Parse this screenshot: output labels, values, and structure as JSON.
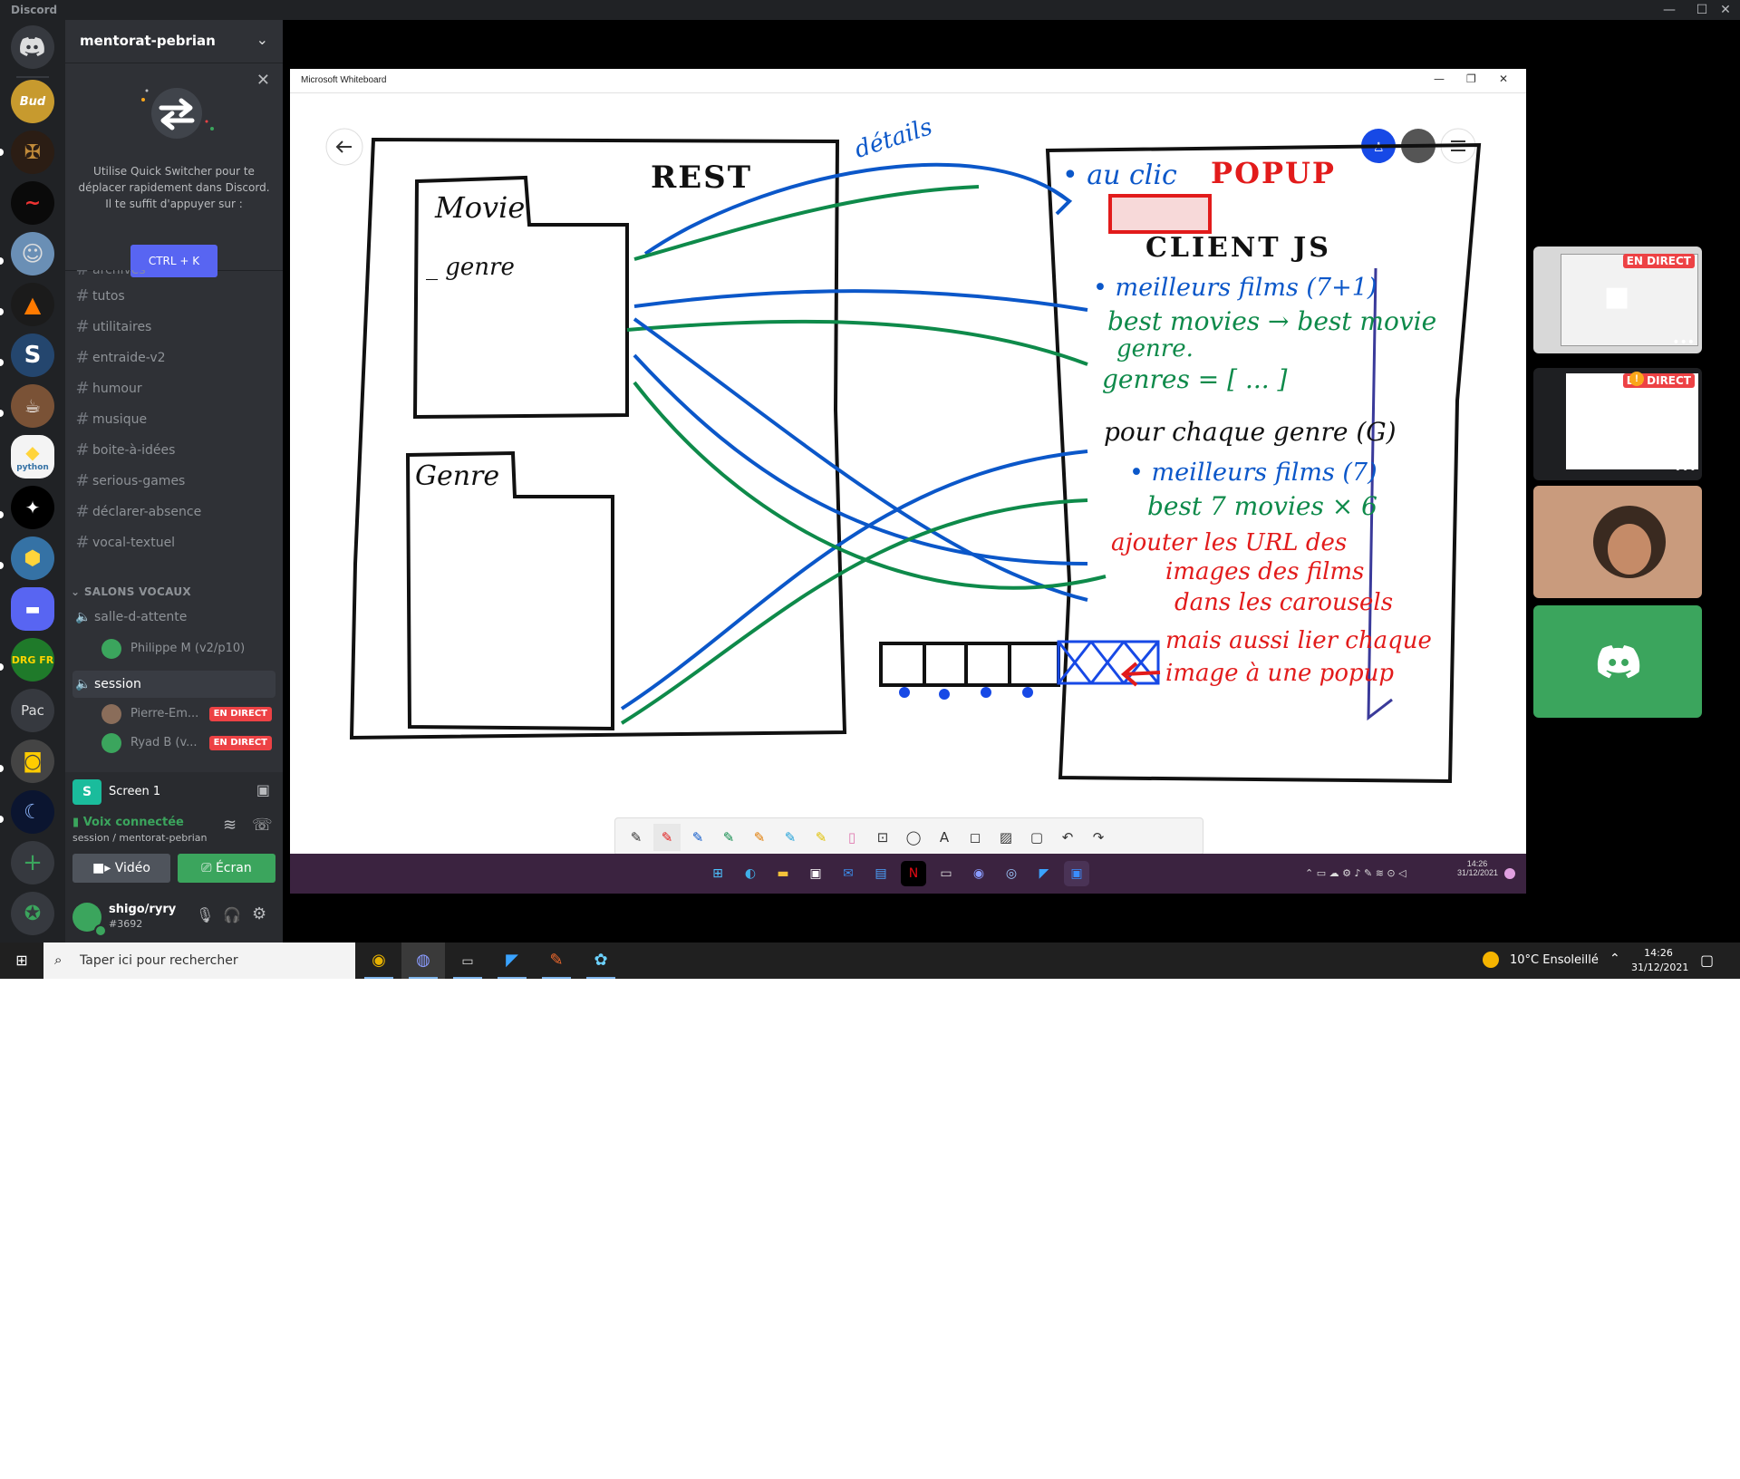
{
  "window": {
    "title": "Discord",
    "minimize": "—",
    "maximize": "☐",
    "close": "✕"
  },
  "guilds": {
    "bud_label": "Bud",
    "pac_label": "Pac",
    "python_label": "python",
    "drg_label": "DRG FR",
    "add_icon": "plus-icon",
    "explore_icon": "compass-icon"
  },
  "server": {
    "name": "mentorat-pebrian"
  },
  "quick_switcher": {
    "text_line1": "Utilise Quick Switcher pour te",
    "text_line2": "déplacer rapidement dans Discord.",
    "text_line3": "Il te suffit d'appuyer sur :",
    "shortcut": "CTRL + K"
  },
  "channels": {
    "partial": "archives",
    "items": [
      "tutos",
      "utilitaires",
      "entraide-v2",
      "humour",
      "musique",
      "boite-à-idées",
      "serious-games",
      "déclarer-absence",
      "vocal-textuel"
    ]
  },
  "voice": {
    "category": "SALONS VOCAUX",
    "waiting_room": "salle-d-attente",
    "waiting_user": "Philippe M (v2/p10)",
    "session": "session",
    "session_users": [
      {
        "name": "Pierre-Em...",
        "badge": "EN DIRECT"
      },
      {
        "name": "Ryad B (v...",
        "badge": "EN DIRECT"
      }
    ]
  },
  "screen_share": {
    "label": "Screen 1"
  },
  "connection": {
    "status": "Voix connectée",
    "location": "session / mentorat-pebrian"
  },
  "media_buttons": {
    "video": "Vidéo",
    "screen": "Écran"
  },
  "account": {
    "name": "shigo/ryry",
    "tag": "#3692"
  },
  "whiteboard": {
    "title": "Microsoft Whiteboard",
    "texts": {
      "rest": "REST",
      "movie": "Movie",
      "genre_field": "_ genre",
      "genre_box": "Genre",
      "details": "détails",
      "au_clic": "• au clic",
      "popup": "POPUP",
      "client": "CLIENT JS",
      "best_films": "• meilleurs films (7+1)",
      "best_movies": "best movies → best movie",
      "genre_word": "genre.",
      "genres": "genres = [ ... ]",
      "pour_chaque": "pour chaque genre (G)",
      "best_films4": "• meilleurs films (7)",
      "best7": "best 7 movies × 6",
      "red1": "ajouter les URL des",
      "red2": "images des films",
      "red3": "dans les carousels",
      "red4": "mais aussi lier chaque",
      "red5": "image à une popup"
    },
    "taskbar_time": "14:26",
    "taskbar_date": "31/12/2021"
  },
  "tiles": {
    "live1": "EN DIRECT",
    "live2": "EN DIRECT"
  },
  "taskbar": {
    "search_placeholder": "Taper ici pour rechercher",
    "weather": "10°C  Ensoleillé",
    "time": "14:26",
    "date": "31/12/2021"
  },
  "colors": {
    "blurple": "#5865f2",
    "green": "#3ba55d",
    "red": "#ed4245",
    "ink_blue": "#0b57c9",
    "ink_green": "#0e8a4a",
    "ink_red": "#e21b1b"
  }
}
